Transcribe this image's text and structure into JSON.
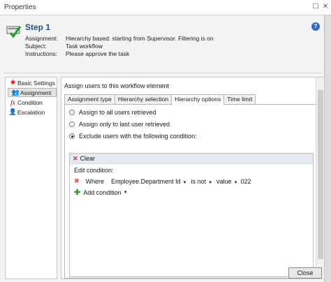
{
  "window": {
    "title": "Properties"
  },
  "header": {
    "step_title": "Step 1",
    "assignment_label": "Assignment:",
    "assignment_value": "Hierarchy based: starting from Supervisor. Filtering is on",
    "subject_label": "Subject:",
    "subject_value": "Task workflow",
    "instructions_label": "Instructions:",
    "instructions_value": "Please approve the task",
    "help": "?"
  },
  "sidebar": {
    "items": [
      {
        "label": "Basic Settings"
      },
      {
        "label": "Assignment"
      },
      {
        "label": "Condition"
      },
      {
        "label": "Escalation"
      }
    ]
  },
  "main": {
    "title": "Assign users to this workflow element",
    "tabs": [
      {
        "label": "Assignment type"
      },
      {
        "label": "Hierarchy selection"
      },
      {
        "label": "Hierarchy options"
      },
      {
        "label": "Time limit"
      }
    ],
    "options": [
      {
        "label": "Assign to all users retrieved",
        "selected": false
      },
      {
        "label": "Assign only to last user retrieved",
        "selected": false
      },
      {
        "label": "Exclude users with the following condition:",
        "selected": true
      }
    ],
    "condition": {
      "clear_label": "Clear",
      "edit_label": "Edit condition:",
      "where": "Where",
      "field": "Employee.Department Id",
      "operator": "is not",
      "value_kind": "value",
      "value": "022",
      "add_label": "Add condition"
    }
  },
  "footer": {
    "close_label": "Close"
  }
}
